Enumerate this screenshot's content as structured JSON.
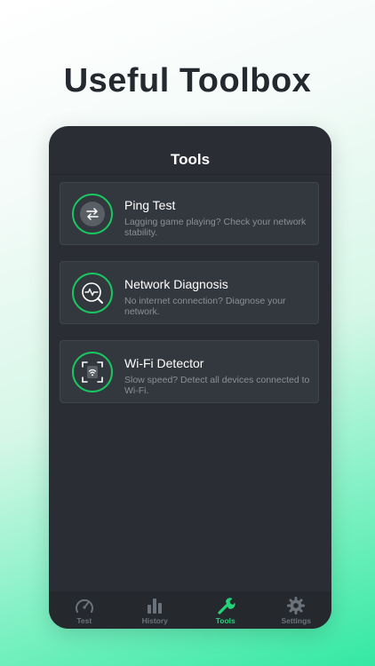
{
  "headline": "Useful Toolbox",
  "screen": {
    "title": "Tools",
    "tools": [
      {
        "title": "Ping Test",
        "description": "Lagging game playing? Check your network stability.",
        "icon": "ping-arrows-icon"
      },
      {
        "title": "Network Diagnosis",
        "description": "No internet connection? Diagnose your network.",
        "icon": "diagnosis-pulse-icon"
      },
      {
        "title": "Wi-Fi Detector",
        "description": "Slow speed? Detect all devices connected to Wi-Fi.",
        "icon": "wifi-scan-icon"
      }
    ]
  },
  "tabbar": {
    "items": [
      {
        "label": "Test",
        "icon": "speedometer-icon",
        "active": false
      },
      {
        "label": "History",
        "icon": "bar-chart-icon",
        "active": false
      },
      {
        "label": "Tools",
        "icon": "wrench-icon",
        "active": true
      },
      {
        "label": "Settings",
        "icon": "gear-icon",
        "active": false
      }
    ]
  },
  "colors": {
    "accent": "#23d47a",
    "ring": "#19c760",
    "card_bg": "#33373e",
    "screen_bg": "#2a2e34"
  }
}
